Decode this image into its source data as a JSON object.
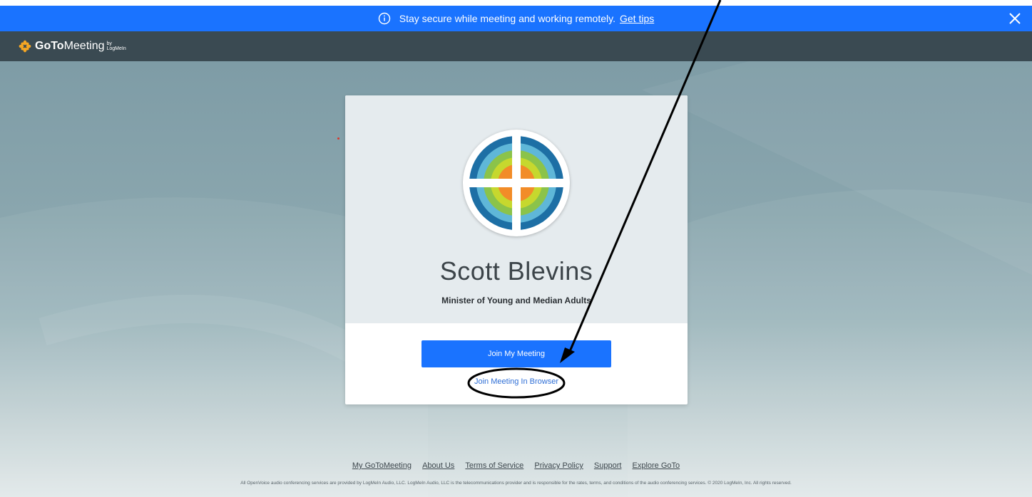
{
  "banner": {
    "message": "Stay secure while meeting and working remotely.",
    "link_label": "Get tips",
    "color": "#1a73ff"
  },
  "header": {
    "logo_goto": "GoTo",
    "logo_meeting": "Meeting",
    "logo_by": "by",
    "logo_logmein": "LogMeIn"
  },
  "card": {
    "name": "Scott Blevins",
    "subtitle": "Minister of Young and Median Adults",
    "join_button": "Join My Meeting",
    "browser_link": "Join Meeting In Browser"
  },
  "footer": {
    "links": [
      "My GoToMeeting",
      "About Us",
      "Terms of Service",
      "Privacy Policy",
      "Support",
      "Explore GoTo"
    ],
    "disclaimer": "All OpenVoice audio conferencing services are provided by LogMeIn Audio, LLC. LogMeIn Audio, LLC is the telecommunications provider and is responsible for the rates, terms, and conditions of the audio conferencing services. © 2020 LogMeIn, Inc. All rights reserved."
  },
  "colors": {
    "accent": "#1a73ff",
    "header_bg": "#3a4a52",
    "logo_orange": "#f5a623"
  }
}
